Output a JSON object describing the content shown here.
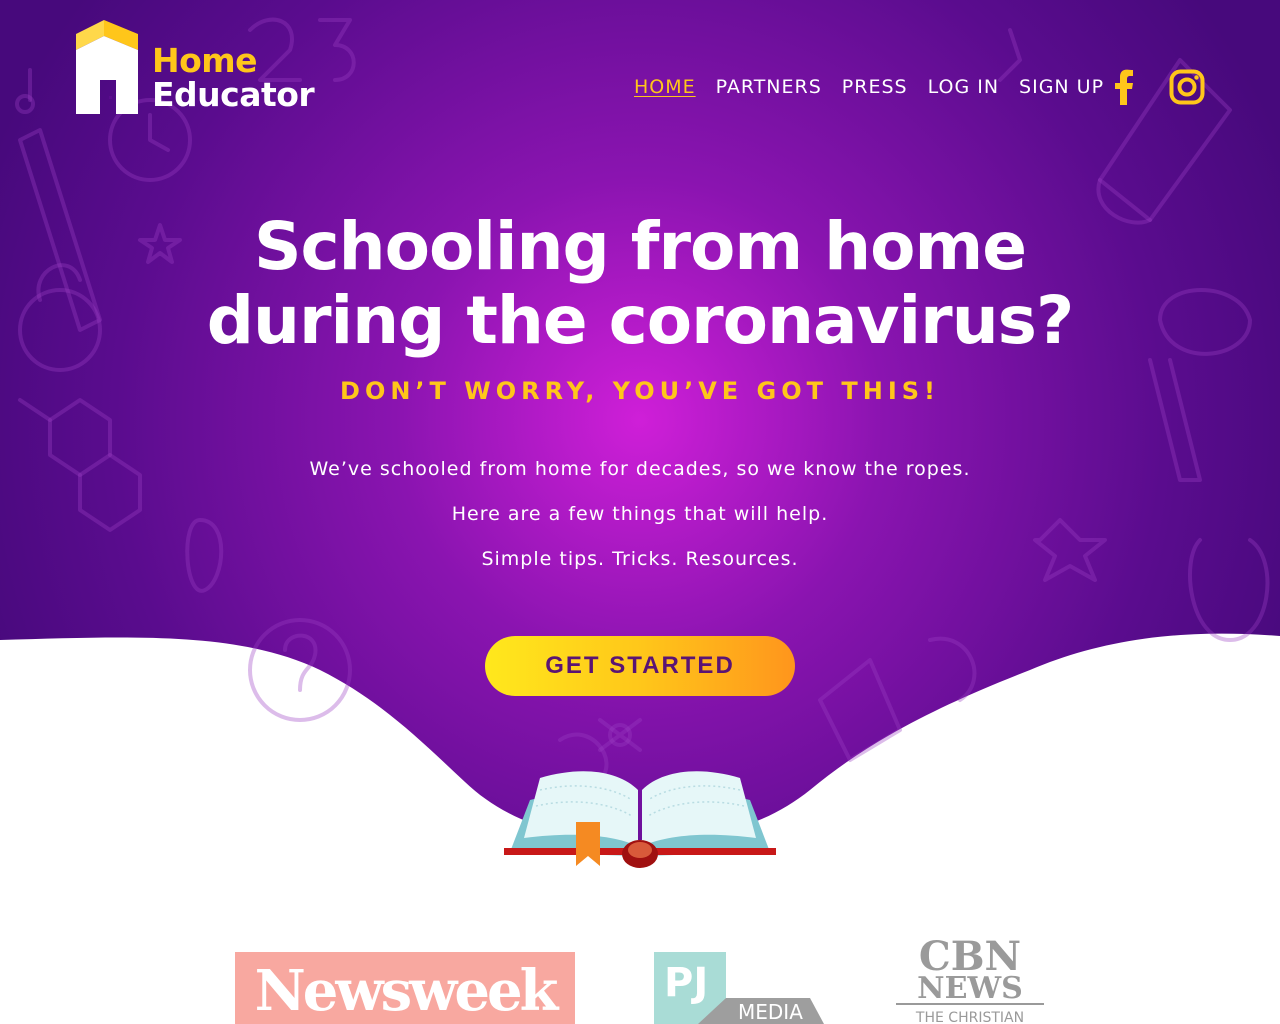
{
  "brand": {
    "name_line1": "Home",
    "name_line2": "Educator"
  },
  "nav": {
    "items": [
      {
        "label": "HOME",
        "active": true
      },
      {
        "label": "PARTNERS",
        "active": false
      },
      {
        "label": "PRESS",
        "active": false
      },
      {
        "label": "LOG IN",
        "active": false
      },
      {
        "label": "SIGN UP",
        "active": false
      }
    ],
    "social": [
      "facebook-icon",
      "instagram-icon"
    ]
  },
  "hero": {
    "headline_line1": "Schooling from home",
    "headline_line2": "during the coronavirus?",
    "subhead": "DON’T WORRY, YOU’VE GOT THIS!",
    "body": [
      "We’ve schooled from home for decades, so we know the ropes.",
      "Here are a few things that will help.",
      "Simple tips. Tricks. Resources."
    ],
    "cta_label": "GET STARTED"
  },
  "press_logos": {
    "newsweek": "Newsweek",
    "pj_media": {
      "mark": "PJ",
      "word": "MEDIA"
    },
    "cbn": {
      "line1": "CBN",
      "line2": "NEWS",
      "line3": "THE CHRISTIAN"
    }
  },
  "colors": {
    "hero_center": "#cc1fd6",
    "hero_edge": "#4a0a82",
    "accent_yellow": "#ffc61a",
    "cta_text": "#5a1474"
  }
}
